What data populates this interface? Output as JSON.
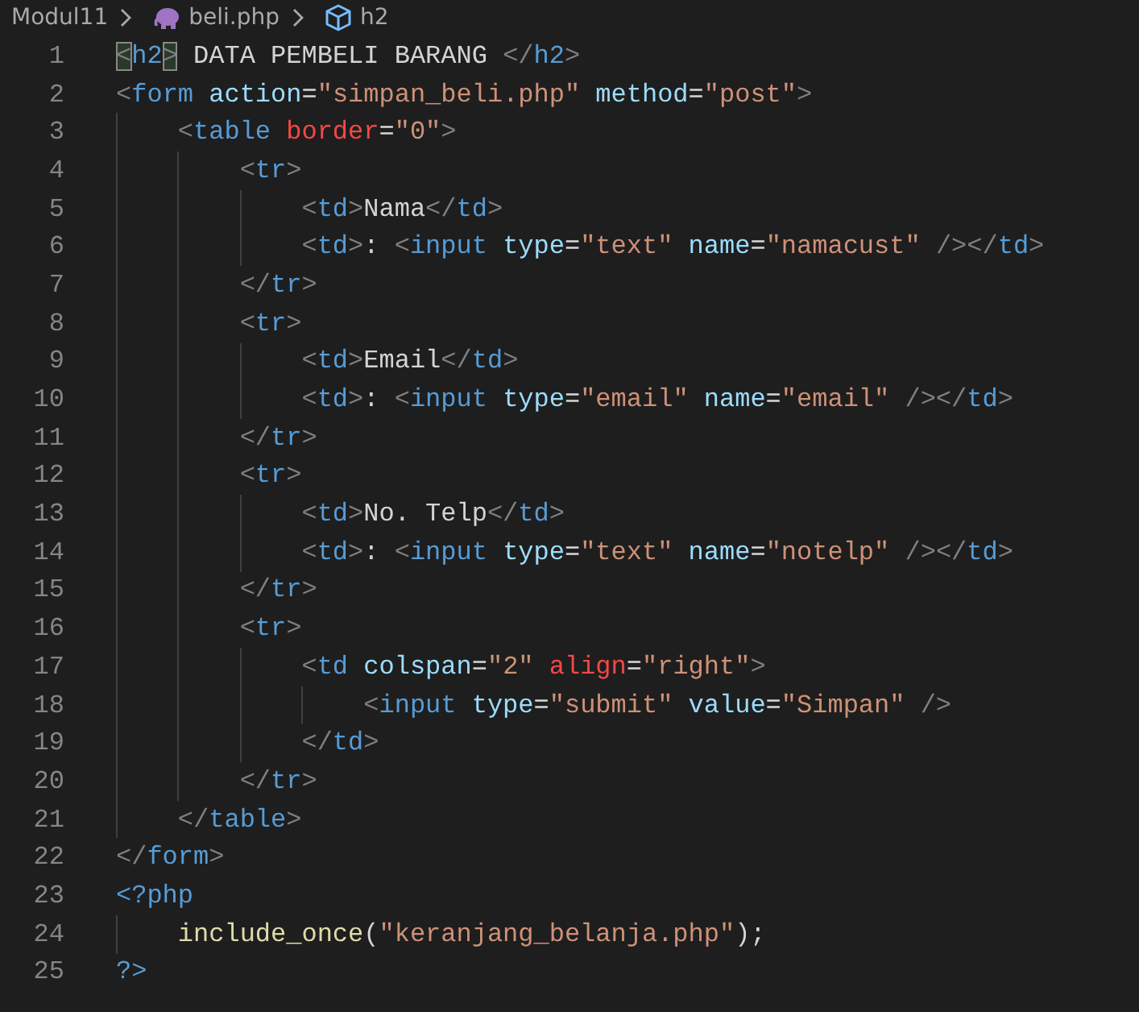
{
  "breadcrumb": [
    {
      "kind": "folder",
      "label": "Modul11"
    },
    {
      "kind": "php-file",
      "label": "beli.php"
    },
    {
      "kind": "element",
      "label": "h2"
    }
  ],
  "lines": [
    {
      "number": "1",
      "tokens": [
        {
          "kind": "punct",
          "text": "<",
          "matched": true
        },
        {
          "kind": "tag",
          "text": "h2"
        },
        {
          "kind": "punct",
          "text": ">",
          "matched": true
        },
        {
          "kind": "text",
          "text": " DATA PEMBELI BARANG "
        },
        {
          "kind": "punct",
          "text": "</"
        },
        {
          "kind": "tag",
          "text": "h2"
        },
        {
          "kind": "punct",
          "text": ">"
        }
      ]
    },
    {
      "number": "2",
      "tokens": [
        {
          "kind": "punct",
          "text": "<"
        },
        {
          "kind": "tag",
          "text": "form "
        },
        {
          "kind": "attr",
          "text": "action"
        },
        {
          "kind": "text",
          "text": "="
        },
        {
          "kind": "string",
          "text": "\"simpan_beli.php\" "
        },
        {
          "kind": "attr",
          "text": "method"
        },
        {
          "kind": "text",
          "text": "="
        },
        {
          "kind": "string",
          "text": "\"post\""
        },
        {
          "kind": "punct",
          "text": ">"
        }
      ]
    },
    {
      "number": "3",
      "tokens": [
        {
          "kind": "punct",
          "text": "    <"
        },
        {
          "kind": "tag",
          "text": "table "
        },
        {
          "kind": "invalid",
          "text": "border"
        },
        {
          "kind": "text",
          "text": "="
        },
        {
          "kind": "string",
          "text": "\"0\""
        },
        {
          "kind": "punct",
          "text": ">"
        }
      ]
    },
    {
      "number": "4",
      "tokens": [
        {
          "kind": "punct",
          "text": "        <"
        },
        {
          "kind": "tag",
          "text": "tr"
        },
        {
          "kind": "punct",
          "text": ">"
        }
      ]
    },
    {
      "number": "5",
      "tokens": [
        {
          "kind": "punct",
          "text": "            <"
        },
        {
          "kind": "tag",
          "text": "td"
        },
        {
          "kind": "punct",
          "text": ">"
        },
        {
          "kind": "text",
          "text": "Nama"
        },
        {
          "kind": "punct",
          "text": "</"
        },
        {
          "kind": "tag",
          "text": "td"
        },
        {
          "kind": "punct",
          "text": ">"
        }
      ]
    },
    {
      "number": "6",
      "tokens": [
        {
          "kind": "punct",
          "text": "            <"
        },
        {
          "kind": "tag",
          "text": "td"
        },
        {
          "kind": "punct",
          "text": ">"
        },
        {
          "kind": "text",
          "text": ": "
        },
        {
          "kind": "punct",
          "text": "<"
        },
        {
          "kind": "tag",
          "text": "input "
        },
        {
          "kind": "attr",
          "text": "type"
        },
        {
          "kind": "text",
          "text": "="
        },
        {
          "kind": "string",
          "text": "\"text\" "
        },
        {
          "kind": "attr",
          "text": "name"
        },
        {
          "kind": "text",
          "text": "="
        },
        {
          "kind": "string",
          "text": "\"namacust\" "
        },
        {
          "kind": "punct",
          "text": "/></"
        },
        {
          "kind": "tag",
          "text": "td"
        },
        {
          "kind": "punct",
          "text": ">"
        }
      ]
    },
    {
      "number": "7",
      "tokens": [
        {
          "kind": "punct",
          "text": "        </"
        },
        {
          "kind": "tag",
          "text": "tr"
        },
        {
          "kind": "punct",
          "text": ">"
        }
      ]
    },
    {
      "number": "8",
      "tokens": [
        {
          "kind": "punct",
          "text": "        <"
        },
        {
          "kind": "tag",
          "text": "tr"
        },
        {
          "kind": "punct",
          "text": ">"
        }
      ]
    },
    {
      "number": "9",
      "tokens": [
        {
          "kind": "punct",
          "text": "            <"
        },
        {
          "kind": "tag",
          "text": "td"
        },
        {
          "kind": "punct",
          "text": ">"
        },
        {
          "kind": "text",
          "text": "Email"
        },
        {
          "kind": "punct",
          "text": "</"
        },
        {
          "kind": "tag",
          "text": "td"
        },
        {
          "kind": "punct",
          "text": ">"
        }
      ]
    },
    {
      "number": "10",
      "tokens": [
        {
          "kind": "punct",
          "text": "            <"
        },
        {
          "kind": "tag",
          "text": "td"
        },
        {
          "kind": "punct",
          "text": ">"
        },
        {
          "kind": "text",
          "text": ": "
        },
        {
          "kind": "punct",
          "text": "<"
        },
        {
          "kind": "tag",
          "text": "input "
        },
        {
          "kind": "attr",
          "text": "type"
        },
        {
          "kind": "text",
          "text": "="
        },
        {
          "kind": "string",
          "text": "\"email\" "
        },
        {
          "kind": "attr",
          "text": "name"
        },
        {
          "kind": "text",
          "text": "="
        },
        {
          "kind": "string",
          "text": "\"email\" "
        },
        {
          "kind": "punct",
          "text": "/></"
        },
        {
          "kind": "tag",
          "text": "td"
        },
        {
          "kind": "punct",
          "text": ">"
        }
      ]
    },
    {
      "number": "11",
      "tokens": [
        {
          "kind": "punct",
          "text": "        </"
        },
        {
          "kind": "tag",
          "text": "tr"
        },
        {
          "kind": "punct",
          "text": ">"
        }
      ]
    },
    {
      "number": "12",
      "tokens": [
        {
          "kind": "punct",
          "text": "        <"
        },
        {
          "kind": "tag",
          "text": "tr"
        },
        {
          "kind": "punct",
          "text": ">"
        }
      ]
    },
    {
      "number": "13",
      "tokens": [
        {
          "kind": "punct",
          "text": "            <"
        },
        {
          "kind": "tag",
          "text": "td"
        },
        {
          "kind": "punct",
          "text": ">"
        },
        {
          "kind": "text",
          "text": "No. Telp"
        },
        {
          "kind": "punct",
          "text": "</"
        },
        {
          "kind": "tag",
          "text": "td"
        },
        {
          "kind": "punct",
          "text": ">"
        }
      ]
    },
    {
      "number": "14",
      "tokens": [
        {
          "kind": "punct",
          "text": "            <"
        },
        {
          "kind": "tag",
          "text": "td"
        },
        {
          "kind": "punct",
          "text": ">"
        },
        {
          "kind": "text",
          "text": ": "
        },
        {
          "kind": "punct",
          "text": "<"
        },
        {
          "kind": "tag",
          "text": "input "
        },
        {
          "kind": "attr",
          "text": "type"
        },
        {
          "kind": "text",
          "text": "="
        },
        {
          "kind": "string",
          "text": "\"text\" "
        },
        {
          "kind": "attr",
          "text": "name"
        },
        {
          "kind": "text",
          "text": "="
        },
        {
          "kind": "string",
          "text": "\"notelp\" "
        },
        {
          "kind": "punct",
          "text": "/></"
        },
        {
          "kind": "tag",
          "text": "td"
        },
        {
          "kind": "punct",
          "text": ">"
        }
      ]
    },
    {
      "number": "15",
      "tokens": [
        {
          "kind": "punct",
          "text": "        </"
        },
        {
          "kind": "tag",
          "text": "tr"
        },
        {
          "kind": "punct",
          "text": ">"
        }
      ]
    },
    {
      "number": "16",
      "tokens": [
        {
          "kind": "punct",
          "text": "        <"
        },
        {
          "kind": "tag",
          "text": "tr"
        },
        {
          "kind": "punct",
          "text": ">"
        }
      ]
    },
    {
      "number": "17",
      "tokens": [
        {
          "kind": "punct",
          "text": "            <"
        },
        {
          "kind": "tag",
          "text": "td "
        },
        {
          "kind": "attr",
          "text": "colspan"
        },
        {
          "kind": "text",
          "text": "="
        },
        {
          "kind": "string",
          "text": "\"2\" "
        },
        {
          "kind": "invalid",
          "text": "align"
        },
        {
          "kind": "text",
          "text": "="
        },
        {
          "kind": "string",
          "text": "\"right\""
        },
        {
          "kind": "punct",
          "text": ">"
        }
      ]
    },
    {
      "number": "18",
      "tokens": [
        {
          "kind": "punct",
          "text": "                <"
        },
        {
          "kind": "tag",
          "text": "input "
        },
        {
          "kind": "attr",
          "text": "type"
        },
        {
          "kind": "text",
          "text": "="
        },
        {
          "kind": "string",
          "text": "\"submit\" "
        },
        {
          "kind": "attr",
          "text": "value"
        },
        {
          "kind": "text",
          "text": "="
        },
        {
          "kind": "string",
          "text": "\"Simpan\" "
        },
        {
          "kind": "punct",
          "text": "/>"
        }
      ]
    },
    {
      "number": "19",
      "tokens": [
        {
          "kind": "punct",
          "text": "            </"
        },
        {
          "kind": "tag",
          "text": "td"
        },
        {
          "kind": "punct",
          "text": ">"
        }
      ]
    },
    {
      "number": "20",
      "tokens": [
        {
          "kind": "punct",
          "text": "        </"
        },
        {
          "kind": "tag",
          "text": "tr"
        },
        {
          "kind": "punct",
          "text": ">"
        }
      ]
    },
    {
      "number": "21",
      "tokens": [
        {
          "kind": "punct",
          "text": "    </"
        },
        {
          "kind": "tag",
          "text": "table"
        },
        {
          "kind": "punct",
          "text": ">"
        }
      ]
    },
    {
      "number": "22",
      "tokens": [
        {
          "kind": "punct",
          "text": "</"
        },
        {
          "kind": "tag",
          "text": "form"
        },
        {
          "kind": "punct",
          "text": ">"
        }
      ]
    },
    {
      "number": "23",
      "tokens": [
        {
          "kind": "php",
          "text": "<?php"
        }
      ]
    },
    {
      "number": "24",
      "tokens": [
        {
          "kind": "function",
          "text": "    include_once"
        },
        {
          "kind": "text",
          "text": "("
        },
        {
          "kind": "string",
          "text": "\"keranjang_belanja.php\""
        },
        {
          "kind": "text",
          "text": ");"
        }
      ]
    },
    {
      "number": "25",
      "tokens": [
        {
          "kind": "php",
          "text": "?>"
        }
      ]
    }
  ]
}
